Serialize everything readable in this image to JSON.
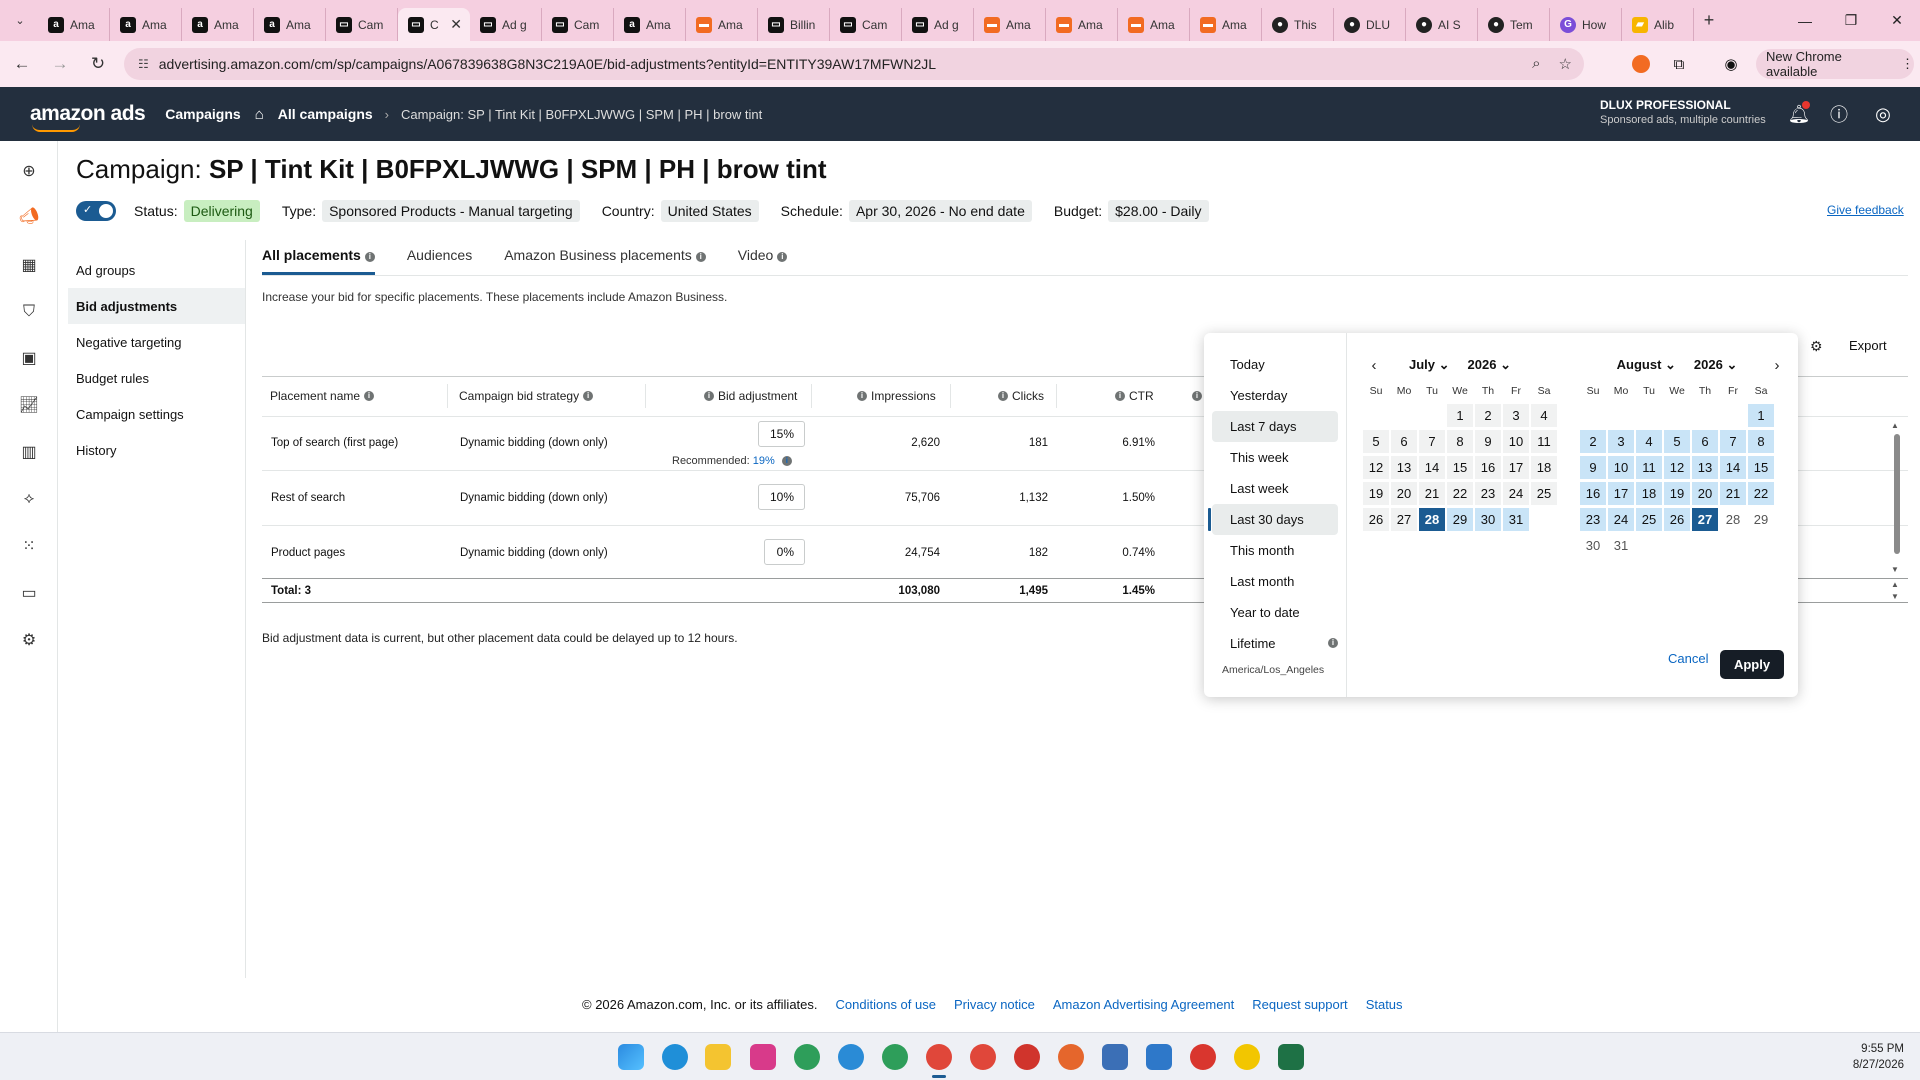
{
  "browser": {
    "tabs": [
      {
        "title": "Ama",
        "icon": "amazon-a-icon"
      },
      {
        "title": "Ama",
        "icon": "amazon-a-icon"
      },
      {
        "title": "Ama",
        "icon": "amazon-a-icon"
      },
      {
        "title": "Ama",
        "icon": "amazon-a-icon"
      },
      {
        "title": "Cam",
        "icon": "campaign-icon"
      },
      {
        "title": "C",
        "icon": "campaign-icon"
      },
      {
        "title": "Ad g",
        "icon": "campaign-icon"
      },
      {
        "title": "Cam",
        "icon": "campaign-icon"
      },
      {
        "title": "Ama",
        "icon": "amazon-a-icon"
      },
      {
        "title": "Ama",
        "icon": "amazon-orange-icon"
      },
      {
        "title": "Billin",
        "icon": "campaign-icon"
      },
      {
        "title": "Cam",
        "icon": "campaign-icon"
      },
      {
        "title": "Ad g",
        "icon": "campaign-icon"
      },
      {
        "title": "Ama",
        "icon": "amazon-orange-icon"
      },
      {
        "title": "Ama",
        "icon": "amazon-orange-icon"
      },
      {
        "title": "Ama",
        "icon": "amazon-orange-icon"
      },
      {
        "title": "Ama",
        "icon": "amazon-orange-icon"
      },
      {
        "title": "This",
        "icon": "circle-icon"
      },
      {
        "title": "DLU",
        "icon": "circle-icon"
      },
      {
        "title": "AI S",
        "icon": "circle-icon"
      },
      {
        "title": "Tem",
        "icon": "circle-icon"
      },
      {
        "title": "How",
        "icon": "g-icon"
      },
      {
        "title": "Alib",
        "icon": "alibaba-icon"
      }
    ],
    "url": "advertising.amazon.com/cm/sp/campaigns/A067839638G8N3C219A0E/bid-adjustments?entityId=ENTITY39AW17MFWN2JL",
    "new_chrome": "New Chrome available"
  },
  "header": {
    "logo": "amazon ads",
    "campaigns": "Campaigns",
    "all_campaigns": "All campaigns",
    "breadcrumb": "Campaign: SP | Tint Kit | B0FPXLJWWG | SPM | PH | brow tint",
    "account_name": "DLUX PROFESSIONAL",
    "account_sub": "Sponsored ads, multiple countries"
  },
  "campaign": {
    "title_prefix": "Campaign:",
    "title_name": "SP | Tint Kit | B0FPXLJWWG | SPM | PH | brow tint",
    "status_label": "Status:",
    "status_value": "Delivering",
    "type_label": "Type:",
    "type_value": "Sponsored Products - Manual targeting",
    "country_label": "Country:",
    "country_value": "United States",
    "schedule_label": "Schedule:",
    "schedule_value": "Apr 30, 2026 - No end date",
    "budget_label": "Budget:",
    "budget_value": "$28.00 - Daily",
    "feedback": "Give feedback"
  },
  "sidenav": [
    "Ad groups",
    "Bid adjustments",
    "Negative targeting",
    "Budget rules",
    "Campaign settings",
    "History"
  ],
  "placement_tabs": [
    "All placements",
    "Audiences",
    "Amazon Business placements",
    "Video"
  ],
  "description": "Increase your bid for specific placements. These placements include Amazon Business.",
  "toolbar": {
    "export": "Export"
  },
  "table": {
    "headers": [
      "Placement name",
      "Campaign bid strategy",
      "Bid adjustment",
      "Impressions",
      "Clicks",
      "CTR"
    ],
    "rows": [
      {
        "name": "Top of search (first page)",
        "strategy": "Dynamic bidding (down only)",
        "bid": "15%",
        "impressions": "2,620",
        "clicks": "181",
        "ctr": "6.91%",
        "recommended_label": "Recommended:",
        "recommended_value": "19%"
      },
      {
        "name": "Rest of search",
        "strategy": "Dynamic bidding (down only)",
        "bid": "10%",
        "impressions": "75,706",
        "clicks": "1,132",
        "ctr": "1.50%"
      },
      {
        "name": "Product pages",
        "strategy": "Dynamic bidding (down only)",
        "bid": "0%",
        "impressions": "24,754",
        "clicks": "182",
        "ctr": "0.74%"
      }
    ],
    "total": {
      "label": "Total: 3",
      "impressions": "103,080",
      "clicks": "1,495",
      "ctr": "1.45%"
    }
  },
  "delay_note": "Bid adjustment data is current, but other placement data could be delayed up to 12 hours.",
  "datepicker": {
    "presets": [
      "Today",
      "Yesterday",
      "Last 7 days",
      "This week",
      "Last week",
      "Last 30 days",
      "This month",
      "Last month",
      "Year to date",
      "Lifetime"
    ],
    "timezone": "America/Los_Angeles",
    "dow": [
      "Su",
      "Mo",
      "Tu",
      "We",
      "Th",
      "Fr",
      "Sa"
    ],
    "left_month": "July",
    "left_year": "2026",
    "right_month": "August",
    "right_year": "2026",
    "cancel": "Cancel",
    "apply": "Apply"
  },
  "footer": {
    "copyright": "© 2026 Amazon.com, Inc. or its affiliates.",
    "links": [
      "Conditions of use",
      "Privacy notice",
      "Amazon Advertising Agreement",
      "Request support",
      "Status"
    ]
  },
  "taskbar": {
    "time": "9:55 PM",
    "date": "8/27/2026"
  },
  "colors": {
    "accent": "#1b5b92",
    "header_bg": "#232f3e",
    "link": "#0a66c2",
    "range_fill": "#c9e4f7"
  }
}
